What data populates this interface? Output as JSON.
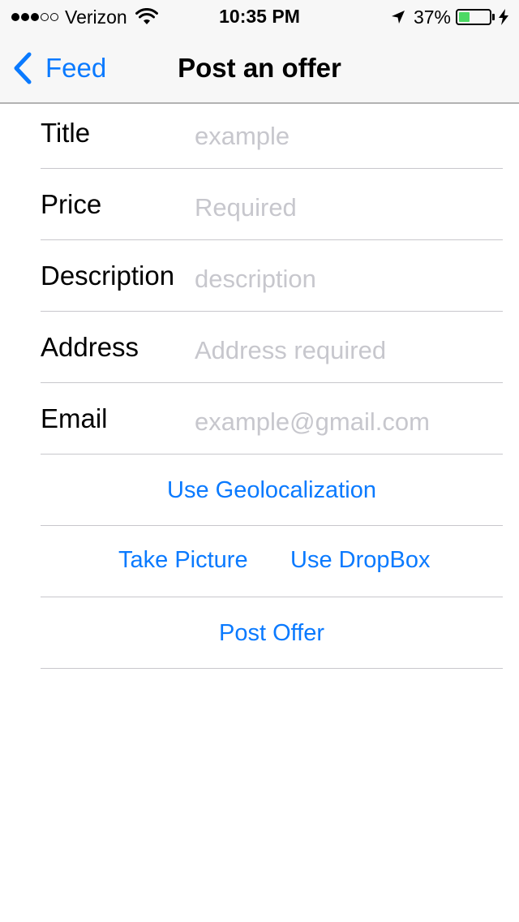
{
  "status_bar": {
    "signal_filled": 3,
    "signal_empty": 2,
    "carrier": "Verizon",
    "time": "10:35 PM",
    "battery_percent": "37%",
    "battery_level": 0.37,
    "battery_color": "#4cd964"
  },
  "nav": {
    "back_label": "Feed",
    "title": "Post an offer"
  },
  "form": {
    "fields": [
      {
        "label": "Title",
        "placeholder": "example",
        "value": ""
      },
      {
        "label": "Price",
        "placeholder": "Required",
        "value": ""
      },
      {
        "label": "Description",
        "placeholder": "description",
        "value": ""
      },
      {
        "label": "Address",
        "placeholder": "Address required",
        "value": ""
      },
      {
        "label": "Email",
        "placeholder": "example@gmail.com",
        "value": ""
      }
    ],
    "geolocation_label": "Use Geolocalization",
    "take_picture_label": "Take Picture",
    "dropbox_label": "Use DropBox",
    "post_label": "Post Offer"
  },
  "colors": {
    "accent": "#0a7aff",
    "placeholder": "#c7c7cd",
    "separator": "#c8c7cc",
    "nav_background": "#f7f7f7"
  },
  "icons": {
    "back": "chevron-left-icon",
    "wifi": "wifi-icon",
    "location": "location-arrow-icon",
    "charging": "bolt-icon"
  }
}
